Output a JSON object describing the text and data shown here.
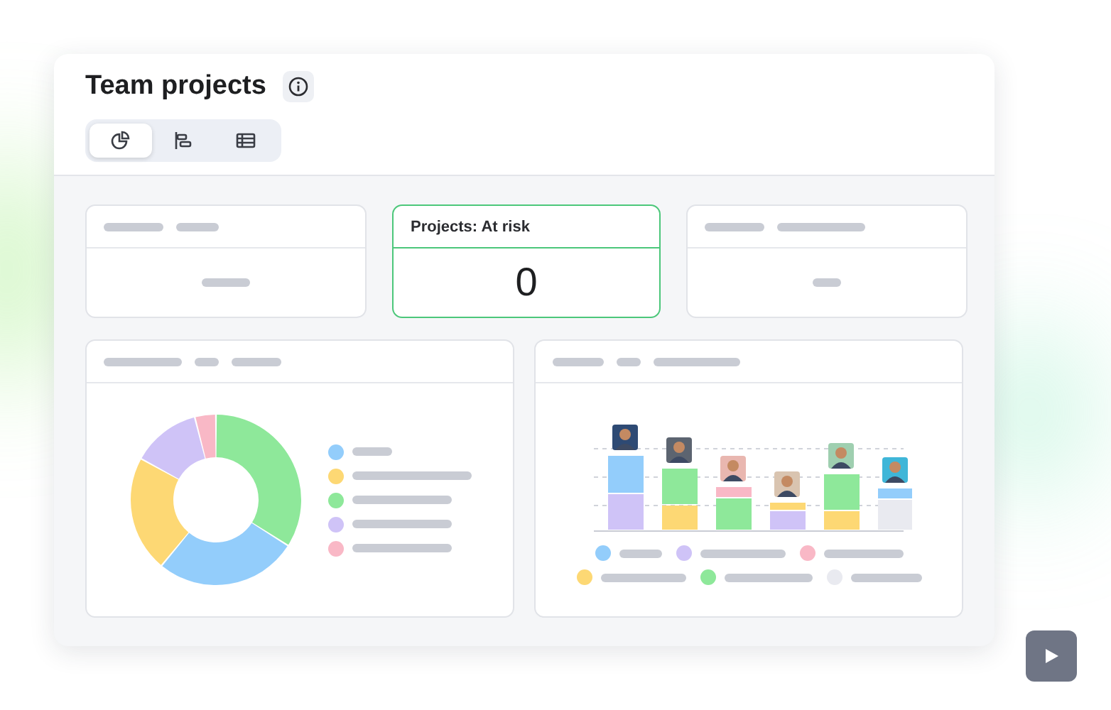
{
  "title": "Team projects",
  "view_tabs": [
    {
      "kind": "chart",
      "selected": true
    },
    {
      "kind": "timeline",
      "selected": false
    },
    {
      "kind": "table",
      "selected": false
    }
  ],
  "cards": [
    {
      "kind": "skeleton",
      "highlighted": false
    },
    {
      "kind": "stat",
      "title": "Projects: At risk",
      "value": "0",
      "highlighted": true
    },
    {
      "kind": "skeleton",
      "highlighted": false
    }
  ],
  "donut_legend": [
    {
      "color": "#93cdfb"
    },
    {
      "color": "#fdd874"
    },
    {
      "color": "#8ee89a"
    },
    {
      "color": "#cfc3f7"
    },
    {
      "color": "#f9b8c6"
    }
  ],
  "bar_legend": [
    {
      "color": "#93cdfb"
    },
    {
      "color": "#cfc3f7"
    },
    {
      "color": "#f9b8c6"
    },
    {
      "color": "#fdd874"
    },
    {
      "color": "#8ee89a"
    },
    {
      "color": "#e9eaf0"
    }
  ]
}
